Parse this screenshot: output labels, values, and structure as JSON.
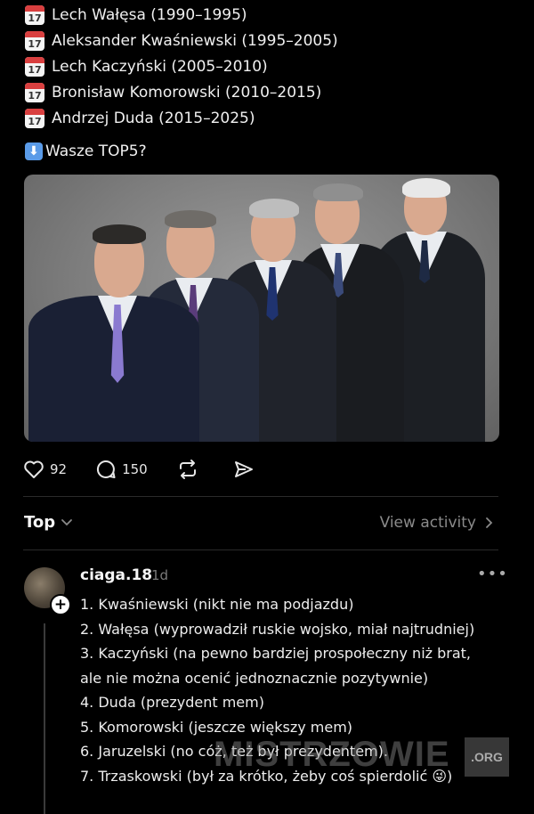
{
  "presidents": [
    {
      "icon": "calendar-icon",
      "day": "17",
      "text": "Lech Wałęsa (1990–1995)"
    },
    {
      "icon": "calendar-icon",
      "day": "17",
      "text": "Aleksander Kwaśniewski (1995–2005)"
    },
    {
      "icon": "calendar-icon",
      "day": "17",
      "text": "Lech Kaczyński (2005–2010)"
    },
    {
      "icon": "calendar-icon",
      "day": "17",
      "text": "Bronisław Komorowski (2010–2015)"
    },
    {
      "icon": "calendar-icon",
      "day": "17",
      "text": "Andrzej Duda (2015–2025)"
    }
  ],
  "question": {
    "icon": "down-arrow-icon",
    "text": "Wasze TOP5?"
  },
  "post_actions": {
    "likes": "92",
    "comments": "150"
  },
  "sort": {
    "label": "Top"
  },
  "view_activity": "View activity",
  "reply": {
    "username": "ciaga.18",
    "time": "1d",
    "more": "•••",
    "lines": [
      "1. Kwaśniewski (nikt nie ma podjazdu)",
      "2. Wałęsa (wyprowadził ruskie wojsko, miał najtrudniej)",
      "3. Kaczyński (na pewno bardziej prospołeczny niż brat,",
      "ale nie można ocenić jednoznacznie pozytywnie)",
      "4. Duda (prezydent mem)",
      "5. Komorowski (jeszcze większy mem)",
      "6. Jaruzelski (no cóż, też był prezydentem).",
      "7. Trzaskowski (był za krótko, żeby coś  spierdolić 😜)"
    ]
  },
  "watermark": {
    "text": "MISTRZOWIE",
    "org": ".ORG"
  },
  "colors": {
    "background": "#000000",
    "text": "#f3f3f3",
    "muted": "#8a8a8a",
    "calendar_red": "#d93f3f"
  }
}
